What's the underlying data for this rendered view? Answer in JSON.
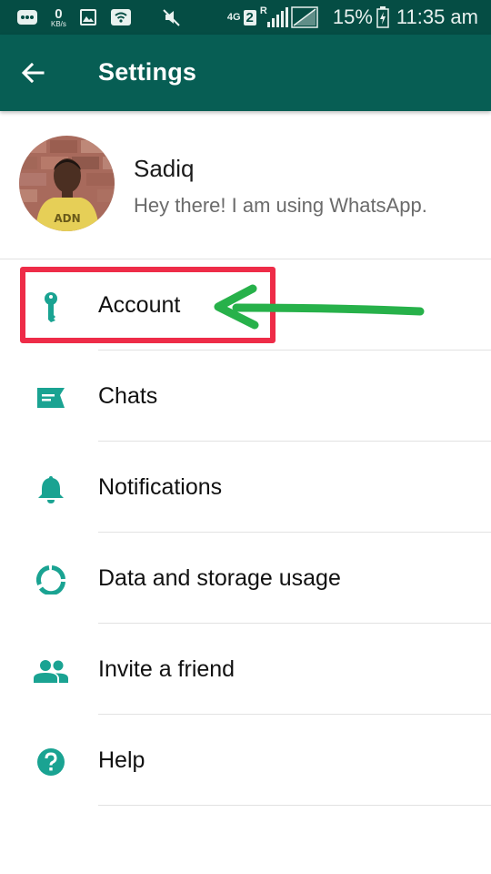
{
  "status_bar": {
    "speed_value": "0",
    "speed_unit": "KB/s",
    "network_label": "4G",
    "sim_slot": "2",
    "roaming": "R",
    "battery": "15%",
    "time": "11:35 am"
  },
  "app_bar": {
    "title": "Settings",
    "back_icon": "arrow-back-icon"
  },
  "profile": {
    "name": "Sadiq",
    "status": "Hey there! I am using WhatsApp."
  },
  "menu": {
    "items": [
      {
        "label": "Account",
        "icon": "key-icon"
      },
      {
        "label": "Chats",
        "icon": "chat-icon"
      },
      {
        "label": "Notifications",
        "icon": "bell-icon"
      },
      {
        "label": "Data and storage usage",
        "icon": "data-usage-icon"
      },
      {
        "label": "Invite a friend",
        "icon": "people-icon"
      },
      {
        "label": "Help",
        "icon": "help-icon"
      }
    ]
  },
  "colors": {
    "status_bar": "#054d44",
    "app_bar": "#075e54",
    "icon_teal": "#1aa392",
    "highlight_red": "#ee2c48",
    "arrow_green": "#27b14a"
  }
}
